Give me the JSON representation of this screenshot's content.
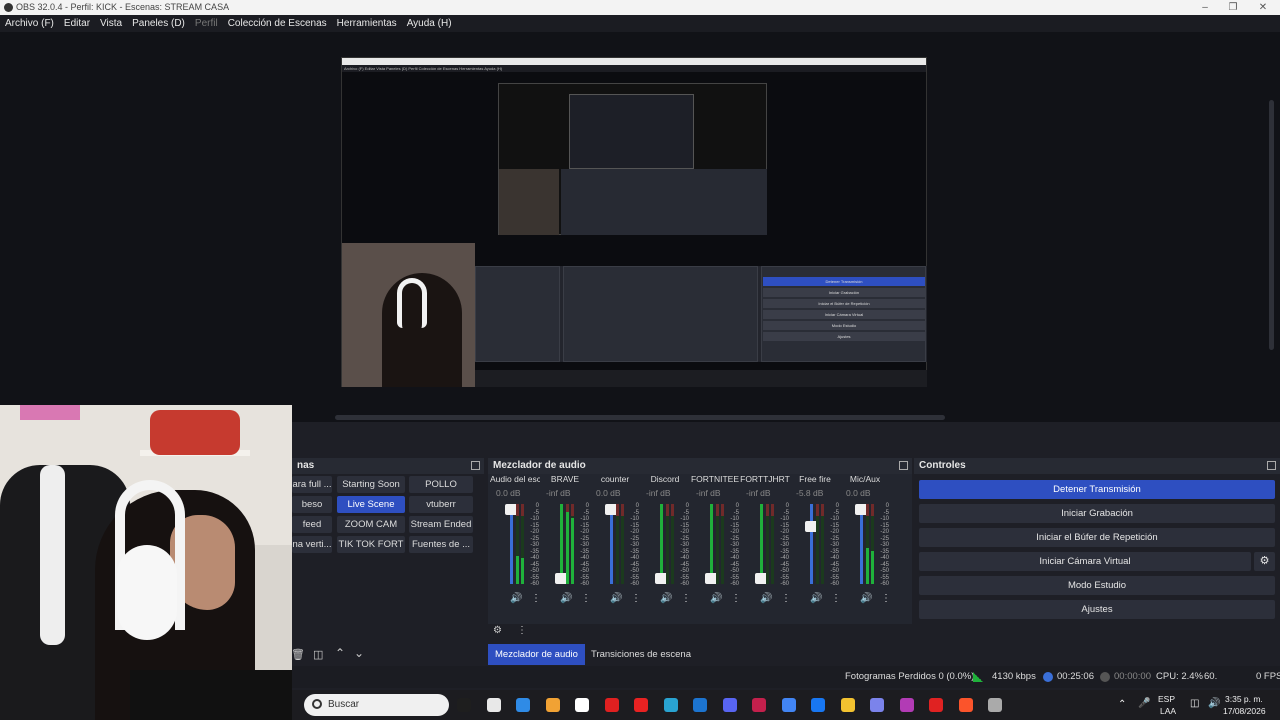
{
  "window": {
    "title": "OBS 32.0.4 - Perfil: KICK - Escenas: STREAM CASA"
  },
  "menu": [
    "Archivo (F)",
    "Editar",
    "Vista",
    "Paneles (D)",
    "Perfil",
    "Colección de Escenas",
    "Herramientas",
    "Ayuda (H)"
  ],
  "nested": {
    "menu": "Archivo (F)  Editar  Vista  Paneles (D)  Perfil  Colección de Escenas  Herramientas  Ayuda (H)",
    "controls": [
      "Detener Transmisión",
      "Iniciar Grabación",
      "Iniciar el Búfer de Repetición",
      "Iniciar Cámara Virtual",
      "Modo Estudio",
      "Ajustes"
    ]
  },
  "scenes": {
    "title": "nas",
    "items": [
      [
        "ara full ...",
        "Starting Soon",
        "POLLO"
      ],
      [
        "beso",
        "Live Scene",
        "vtuberr"
      ],
      [
        "feed",
        "ZOOM CAM",
        "Stream Ended"
      ],
      [
        "na verti...",
        "TIK TOK FORT",
        "Fuentes de ..."
      ]
    ],
    "active": "Live Scene"
  },
  "mixer": {
    "title": "Mezclador de audio",
    "scale": [
      "0",
      "-5",
      "-10",
      "-15",
      "-20",
      "-25",
      "-30",
      "-35",
      "-40",
      "-45",
      "-50",
      "-55",
      "-60"
    ],
    "channels": [
      {
        "name": "Audio del escritorio",
        "db": "0.0 dB",
        "level": 0.35,
        "fader": 1.0,
        "color": "#3a6fd8"
      },
      {
        "name": "BRAVE",
        "db": "-inf dB",
        "level": 0.9,
        "fader": 0.0,
        "color": "#1fb13b"
      },
      {
        "name": "counter",
        "db": "0.0 dB",
        "level": 0.0,
        "fader": 1.0,
        "color": "#3a6fd8"
      },
      {
        "name": "Discord",
        "db": "-inf dB",
        "level": 0.0,
        "fader": 0.0,
        "color": "#1fb13b"
      },
      {
        "name": "FORTNITEE",
        "db": "-inf dB",
        "level": 0.0,
        "fader": 0.0,
        "color": "#1fb13b"
      },
      {
        "name": "FORTTJHRT",
        "db": "-inf dB",
        "level": 0.0,
        "fader": 0.0,
        "color": "#1fb13b"
      },
      {
        "name": "Free fire",
        "db": "-5.8 dB",
        "level": 0.0,
        "fader": 0.75,
        "color": "#3a6fd8"
      },
      {
        "name": "Mic/Aux",
        "db": "0.0 dB",
        "level": 0.45,
        "fader": 1.0,
        "color": "#3a6fd8"
      }
    ]
  },
  "controls": {
    "title": "Controles",
    "buttons": [
      "Detener Transmisión",
      "Iniciar Grabación",
      "Iniciar el Búfer de Repetición",
      "Iniciar Cámara Virtual",
      "Modo Estudio",
      "Ajustes"
    ]
  },
  "tabs": [
    "Mezclador de audio",
    "Transiciones de escena"
  ],
  "status": {
    "dropped": "Fotogramas Perdidos 0 (0.0%)",
    "bitrate": "4130 kbps",
    "stream_time": "00:25:06",
    "rec_time": "00:00:00",
    "cpu": "CPU: 2.4%",
    "fps_prefix": "60.",
    "fps_suffix": "0 FPS"
  },
  "taskbar": {
    "search": "Buscar",
    "lang_top": "ESP",
    "lang_bottom": "LAA",
    "time": "3:35 p. m.",
    "date": "17/08/2026",
    "icon_colors": [
      "#1e1e1e",
      "#e8e8e8",
      "#2f8be6",
      "#f1a234",
      "#ffffff",
      "#e02020",
      "#e82222",
      "#29a3d1",
      "#1c74d0",
      "#5865f2",
      "#c3204c",
      "#4285f4",
      "#1877f2",
      "#f2c230",
      "#7b83eb",
      "#b23bb5",
      "#e02222",
      "#fb542b",
      "#aaaaaa"
    ]
  }
}
